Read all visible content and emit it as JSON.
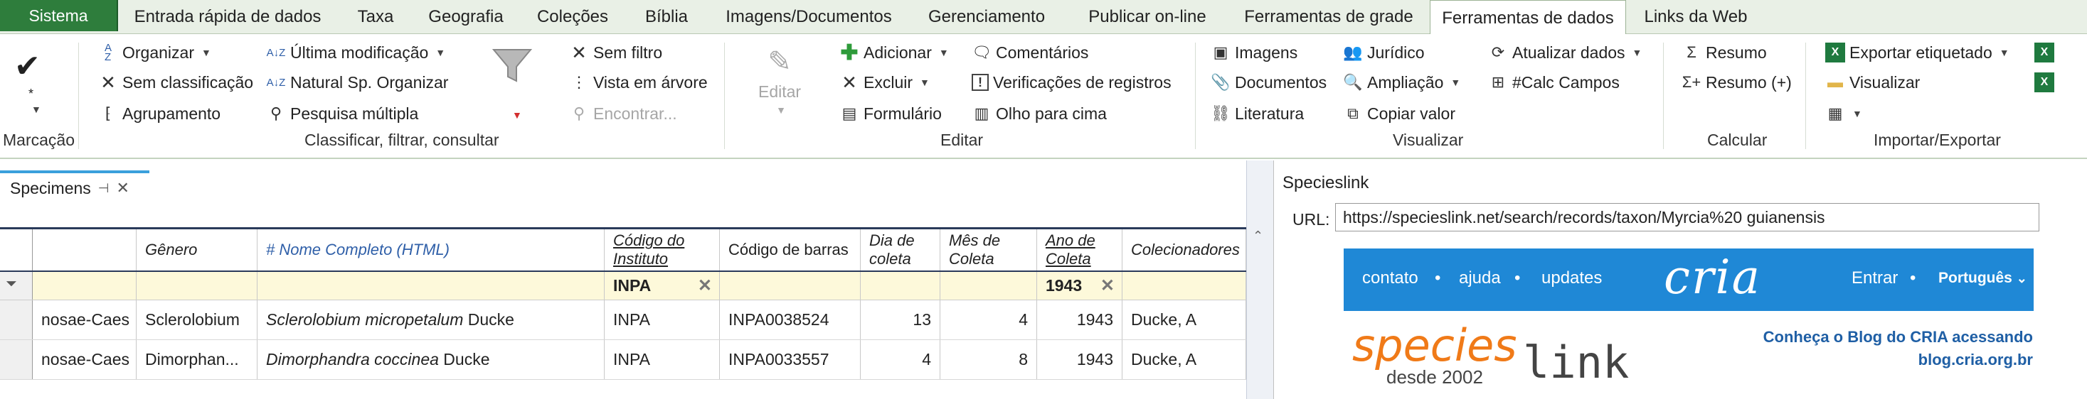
{
  "menubar": {
    "system": "Sistema",
    "tabs": [
      "Entrada rápida de dados",
      "Taxa",
      "Geografia",
      "Coleções",
      "Bíblia",
      "Imagens/Documentos",
      "Gerenciamento",
      "Publicar on-line",
      "Ferramentas de grade",
      "Ferramentas de dados",
      "Links da Web"
    ],
    "active_tab": "Ferramentas de dados"
  },
  "ribbon": {
    "marcacao": {
      "label": "Marcação",
      "star": "*"
    },
    "classificar": {
      "organizar": "Organizar",
      "sem_classificacao": "Sem classificação",
      "agrupamento": "Agrupamento",
      "ultima_modificacao": "Última modificação",
      "natural_sp": "Natural Sp. Organizar",
      "pesquisa_multipla": "Pesquisa múltipla",
      "sem_filtro": "Sem filtro",
      "vista_arvore": "Vista em árvore",
      "encontrar": "Encontrar...",
      "label": "Classificar, filtrar, consultar"
    },
    "editar": {
      "editar": "Editar",
      "adicionar": "Adicionar",
      "excluir": "Excluir",
      "formulario": "Formulário",
      "comentarios": "Comentários",
      "verificacoes": "Verificações de registros",
      "olho": "Olho para cima",
      "label": "Editar"
    },
    "visualizar": {
      "imagens": "Imagens",
      "documentos": "Documentos",
      "literatura": "Literatura",
      "juridico": "Jurídico",
      "ampliacao": "Ampliação",
      "copiar_valor": "Copiar valor",
      "atualizar_dados": "Atualizar dados",
      "calc_campos": "#Calc Campos",
      "label": "Visualizar"
    },
    "calcular": {
      "resumo": "Resumo",
      "resumo_plus": "Resumo (+)",
      "label": "Calcular"
    },
    "importar": {
      "exportar_etiquetado": "Exportar etiquetado",
      "visualizar": "Visualizar",
      "label": "Importar/Exportar"
    }
  },
  "document": {
    "tab_title": "Specimens",
    "columns": [
      "Gênero",
      "# Nome Completo (HTML)",
      "Código do Instituto",
      "Código de barras",
      "Dia de coleta",
      "Mês de Coleta",
      "Ano de Coleta",
      "Colecionadores"
    ],
    "filter": {
      "instituto": "INPA",
      "ano": "1943"
    },
    "rows": [
      {
        "family": "nosae-Caes",
        "genero": "Sclerolobium",
        "nome_it": "Sclerolobium micropetalum",
        "autor": " Ducke",
        "instituto": "INPA",
        "barcode": "INPA0038524",
        "dia": "13",
        "mes": "4",
        "ano": "1943",
        "coletor": "Ducke, A"
      },
      {
        "family": "nosae-Caes",
        "genero": "Dimorphan...",
        "nome_it": "Dimorphandra coccinea",
        "autor": " Ducke",
        "instituto": "INPA",
        "barcode": "INPA0033557",
        "dia": "4",
        "mes": "8",
        "ano": "1943",
        "coletor": "Ducke, A"
      }
    ]
  },
  "web": {
    "title": "Specieslink",
    "url_label": "URL:",
    "url": "https://specieslink.net/search/records/taxon/Myrcia%20 guianensis",
    "nav": [
      "contato",
      "ajuda",
      "updates"
    ],
    "logo": "cria",
    "entrar": "Entrar",
    "lang": "Português",
    "species_logo_a": "species",
    "species_logo_b": "link",
    "since": "desde 2002",
    "promo1": "Conheça o Blog do CRIA acessando",
    "promo2": "blog.cria.org.br",
    "colors": {
      "bar": "#1f88d6",
      "logo_orange": "#f07a18"
    }
  }
}
